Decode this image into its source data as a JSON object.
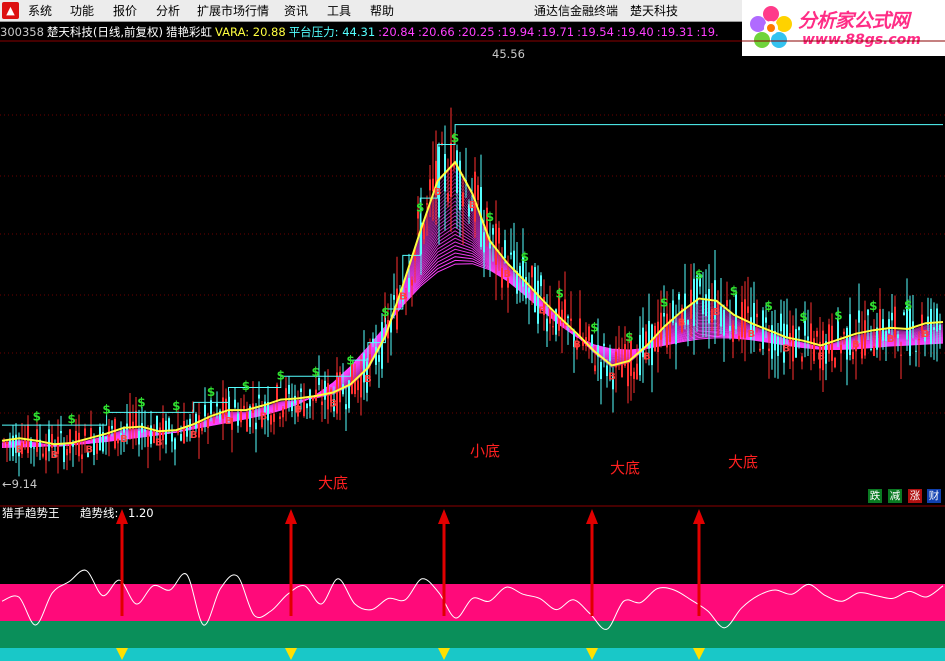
{
  "menu": {
    "logo": "▲",
    "items": [
      "系统",
      "功能",
      "报价",
      "分析",
      "扩展市场行情",
      "资讯",
      "工具",
      "帮助"
    ]
  },
  "window_title": {
    "app": "通达信金融终端",
    "stock": "楚天科技"
  },
  "brand": {
    "name": "分析家公式网",
    "url": "www.88gs.com"
  },
  "info": {
    "code": "300358",
    "name": "楚天科技(日线,前复权)",
    "indicator": "猎艳彩虹",
    "vara": "VARA: 20.88",
    "platform_label": "平台压力: 44.31",
    "levels": [
      ":20.84",
      ":20.66",
      ":20.25",
      ":19.94",
      ":19.71",
      ":19.54",
      ":19.40",
      ":19.31",
      ":19."
    ]
  },
  "price_labels": {
    "high": "45.56",
    "low": "←9.14"
  },
  "annotations": [
    "大底",
    "小底",
    "大底",
    "大底"
  ],
  "lower_panel": {
    "name": "猎手趋势王",
    "trend_label": "趋势线:",
    "trend_value": "1.20"
  },
  "flags": [
    "跌",
    "减",
    "涨",
    "财"
  ],
  "colors": {
    "background": "#000000",
    "rainbow": "#ff40ff",
    "ma_line": "#ffff40",
    "up_candle": "#ff3030",
    "down_candle": "#54ffff",
    "buy_signal": "#30e030",
    "sell_signal": "#ff4040",
    "arrow": "#e00000",
    "band_pink": "#ff0a7a",
    "band_green": "#0a8f5a",
    "band_cyan": "#19c8c8"
  },
  "chart_data": {
    "type": "line",
    "title": "300358 楚天科技(日线,前复权)",
    "xlabel": "",
    "ylabel": "",
    "ylim": [
      9.14,
      45.56
    ],
    "series": [
      {
        "name": "猎艳彩虹",
        "values": [
          12.4,
          12.6,
          12.4,
          12.1,
          12.2,
          12.6,
          13.0,
          13.5,
          13.6,
          13.2,
          13.3,
          13.8,
          14.5,
          15.0,
          15.0,
          15.4,
          15.9,
          16.0,
          16.2,
          16.5,
          17.2,
          18.6,
          21.3,
          25.6,
          30.2,
          34.5,
          36.1,
          33.4,
          29.4,
          27.5,
          26.0,
          24.4,
          22.9,
          21.5,
          20.0,
          18.8,
          19.2,
          20.5,
          22.1,
          23.4,
          24.5,
          24.3,
          23.1,
          22.4,
          21.8,
          21.2,
          20.9,
          20.5,
          21.0,
          21.5,
          21.8,
          22.0,
          21.9,
          22.4,
          22.5
        ]
      },
      {
        "name": "趋势线",
        "values": [
          1.2,
          1.5,
          -0.5,
          1.8,
          2.6,
          3.4,
          1.6,
          2.7,
          1.0,
          2.3,
          2.0,
          3.1,
          -0.5,
          2.1,
          3.0,
          0.2,
          0.5,
          1.7,
          2.3,
          1.0,
          2.8,
          1.0,
          0.6,
          1.4,
          1.3,
          2.8,
          1.8,
          0.0,
          1.4,
          1.2,
          2.2,
          1.7,
          1.4,
          0.6,
          1.3,
          0.3,
          -0.8,
          1.2,
          1.1,
          2.1,
          2.0,
          1.3,
          0.5,
          -0.7,
          0.7,
          1.6,
          2.0,
          1.7,
          2.4,
          1.6,
          1.2,
          1.8,
          1.6,
          1.4,
          1.9,
          1.5,
          2.3
        ]
      }
    ]
  }
}
